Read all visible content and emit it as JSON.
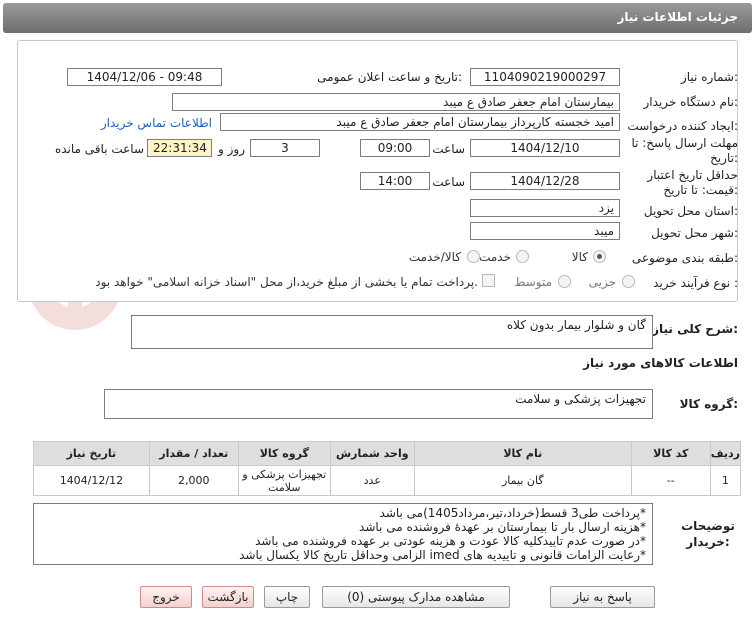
{
  "header": {
    "title": "جزئیات اطلاعات نیاز"
  },
  "watermark": {
    "text": "AriaTender.neT"
  },
  "form": {
    "need_number": {
      "label": "شماره نیاز:",
      "value": "1104090219000297"
    },
    "announce": {
      "label": "تاریخ و ساعت اعلان عمومی:",
      "value": "1404/12/06 - 09:48"
    },
    "buyer_org": {
      "label": "نام دستگاه خریدار:",
      "value": "بیمارستان امام جعفر صادق  ع  میبد"
    },
    "requester": {
      "label": "ایجاد کننده درخواست:",
      "value": "امید خجسته کارپرداز بیمارستان امام جعفر صادق  ع  میبد",
      "contact_link": "اطلاعات تماس خریدار"
    },
    "reply_deadline": {
      "label": "مهلت ارسال پاسخ: تا تاریخ:",
      "date": "1404/12/10",
      "time_label": "ساعت",
      "time": "09:00",
      "days": "3",
      "days_label": "روز و",
      "remaining": "22:31:34",
      "remaining_label": "ساعت باقی مانده"
    },
    "price_validity": {
      "label": "حداقل تاریخ اعتبار قیمت: تا تاریخ:",
      "date": "1404/12/28",
      "time_label": "ساعت",
      "time": "14:00"
    },
    "province": {
      "label": "استان محل تحویل:",
      "value": "یزد"
    },
    "city": {
      "label": "شهر محل تحویل:",
      "value": "میبد"
    },
    "category": {
      "label": "طبقه بندی موضوعی:",
      "options": [
        "کالا",
        "خدمت",
        "کالا/خدمت"
      ],
      "selected": "کالا"
    },
    "process": {
      "label": "نوع فرآیند خرید :",
      "options": [
        "جزیی",
        "متوسط"
      ],
      "selected": "",
      "payment_note": "پرداخت تمام یا بخشی از مبلغ خرید،از محل \"اسناد خزانه اسلامی\" خواهد بود."
    }
  },
  "summary": {
    "label": "شرح کلی نیاز:",
    "value": "گان و شلوار بیمار بدون کلاه"
  },
  "goods_info": {
    "heading": "اطلاعات کالاهای مورد نیاز"
  },
  "goods_group": {
    "label": "گروه کالا:",
    "value": "تجهیزات پزشکی و سلامت"
  },
  "table": {
    "headers": [
      "ردیف",
      "کد کالا",
      "نام کالا",
      "واحد شمارش",
      "گروه کالا",
      "تعداد / مقدار",
      "تاریخ نیاز"
    ],
    "rows": [
      [
        "1",
        "--",
        "گان بیمار",
        "عدد",
        "تجهیزات پزشکی و سلامت",
        "2,000",
        "1404/12/12"
      ]
    ]
  },
  "buyer_notes": {
    "label": "توضیحات خریدار:",
    "lines": [
      "*پرداخت طی3 قسط(خرداد،تیر،مرداد1405)می باشد",
      "*هزینه ارسال بار تا بیمارستان بر عهدهٔ فروشنده می باشد",
      "*در صورت عدم تاییدکلیه کالا عودت و هزینه عودتی بر عهده فروشنده می باشد",
      "*رعایت الزامات قانونی و تاییدیه های imed  الزامی وحداقل تاریخ کالا یکسال باشد"
    ]
  },
  "buttons": {
    "reply": "پاسخ به نیاز",
    "attachments": "مشاهده مدارک پیوستی (0)",
    "print": "چاپ",
    "back": "بازگشت",
    "exit": "خروج"
  },
  "colors": {
    "title_bar": "#7a7a7a",
    "link": "#1f5fbf",
    "remaining_bg": "#fdf4c8"
  }
}
